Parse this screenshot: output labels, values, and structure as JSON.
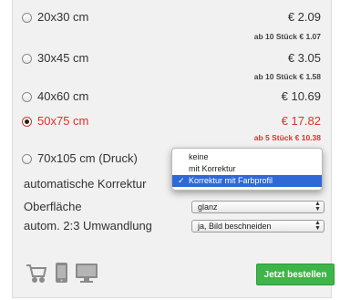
{
  "sizes": [
    {
      "label": "20x30 cm",
      "price": "€ 2.09",
      "bulk": "ab 10 Stück € 1.07",
      "selected": false
    },
    {
      "label": "30x45 cm",
      "price": "€ 3.05",
      "bulk": "ab 10 Stück € 1.58",
      "selected": false
    },
    {
      "label": "40x60 cm",
      "price": "€ 10.69",
      "bulk": "",
      "selected": false
    },
    {
      "label": "50x75 cm",
      "price": "€ 17.82",
      "bulk": "ab 5 Stück € 10.38",
      "selected": true
    },
    {
      "label": "70x105 cm (Druck)",
      "price": "",
      "bulk": "",
      "selected": false
    }
  ],
  "options": {
    "auto_correction": {
      "label": "automatische Korrektur"
    },
    "surface": {
      "label": "Oberfläche",
      "value": "glanz"
    },
    "conversion": {
      "label": "autom. 2:3 Umwandlung",
      "value": "ja, Bild beschneiden"
    }
  },
  "dropdown": {
    "items": [
      "keine",
      "mit Korrektur",
      "Korrektur mit Farbprofil"
    ],
    "checked_mark": "✓",
    "selected_index": 2
  },
  "icons": [
    "cart-icon",
    "phone-icon",
    "monitor-icon"
  ],
  "order_button": {
    "label": "Jetzt bestellen"
  },
  "colors": {
    "accent_red": "#e0302a",
    "button_green": "#3db548",
    "menu_highlight": "#2f69d8"
  }
}
